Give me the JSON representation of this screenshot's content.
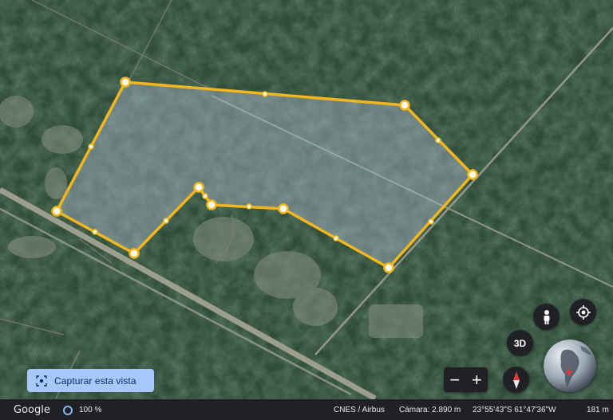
{
  "capture_button": {
    "label": "Capturar esta vista",
    "icon": "capture-icon"
  },
  "controls": {
    "pegman_icon": "person-icon",
    "locate_icon": "crosshair-icon",
    "view3d_label": "3D",
    "zoom_out_label": "−",
    "zoom_in_label": "+",
    "compass_icon": "compass-icon",
    "globe_icon": "globe-icon"
  },
  "status_bar": {
    "logo": "Google",
    "zoom_percent": "100 %",
    "attribution": "CNES / Airbus",
    "camera": "Cámara: 2.890 m",
    "coordinates": "23°55'43\"S 61°47'36\"W",
    "elevation": "181 m"
  },
  "colors": {
    "polygon_stroke": "#f2b61f",
    "polygon_fill": "#a9b9cb",
    "capture_button_bg": "#a8c7fa",
    "control_bg": "#202124",
    "status_bar_bg": "#202124"
  }
}
